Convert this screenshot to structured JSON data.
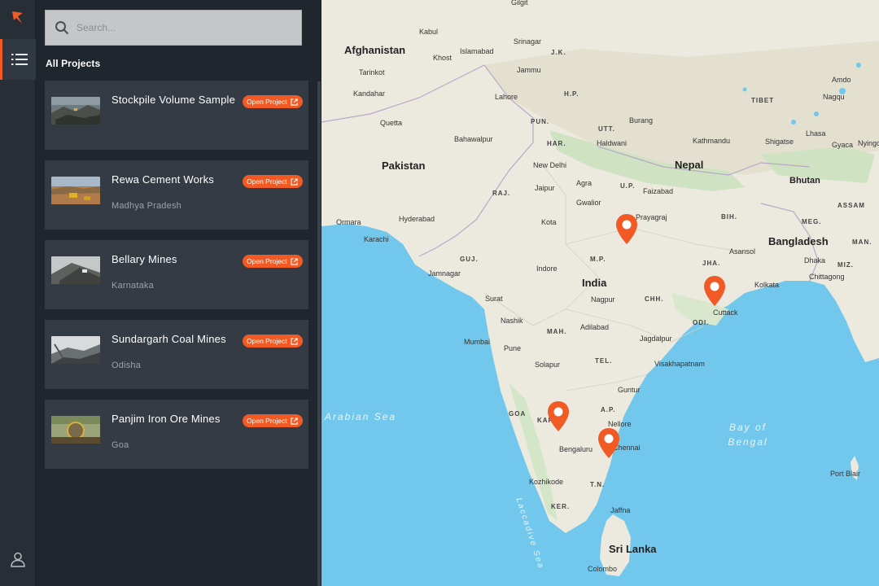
{
  "app": {
    "brand_color": "#f15a24"
  },
  "search": {
    "placeholder": "Search..."
  },
  "sidebar": {
    "section_title": "All Projects"
  },
  "projects": [
    {
      "title": "Stockpile Volume Sample",
      "subtitle": "",
      "button": "Open Project"
    },
    {
      "title": "Rewa Cement Works",
      "subtitle": "Madhya Pradesh",
      "button": "Open Project"
    },
    {
      "title": "Bellary Mines",
      "subtitle": "Karnataka",
      "button": "Open Project"
    },
    {
      "title": "Sundargarh Coal Mines",
      "subtitle": "Odisha",
      "button": "Open Project"
    },
    {
      "title": "Panjim Iron Ore Mines",
      "subtitle": "Goa",
      "button": "Open Project"
    }
  ],
  "map": {
    "countries": [
      "Afghanistan",
      "Pakistan",
      "Nepal",
      "Bhutan",
      "Bangladesh",
      "India",
      "Sri Lanka"
    ],
    "states": [
      "J.K.",
      "H.P.",
      "PUN.",
      "UTT.",
      "HAR.",
      "RAJ.",
      "U.P.",
      "BIH.",
      "GUJ.",
      "M.P.",
      "JHA.",
      "CHH.",
      "ODI.",
      "MAH.",
      "TEL.",
      "A.P.",
      "KAR.",
      "GOA",
      "T.N.",
      "KER.",
      "TIBET",
      "ASSAM",
      "MEG.",
      "MAN.",
      "MIZ."
    ],
    "cities": [
      "Gilgit",
      "Kabul",
      "Srinagar",
      "Khost",
      "Islamabad",
      "Jammu",
      "Tarinkot",
      "Kandahar",
      "Lahore",
      "Quetta",
      "Bahawalpur",
      "Burang",
      "Haldwani",
      "New Delhi",
      "Kathmandu",
      "Lhasa",
      "Gyaca",
      "Nyingchi",
      "Shigatse",
      "Amdo",
      "Nagqu",
      "Jaipur",
      "Agra",
      "Faizabad",
      "Gwalior",
      "Prayagraj",
      "Hyderabad",
      "Ormara",
      "Karachi",
      "Kota",
      "Asansol",
      "Dhaka",
      "Chittagong",
      "Kolkata",
      "Jamnagar",
      "Indore",
      "Surat",
      "Nagpur",
      "Cuttack",
      "Nashik",
      "Adilabad",
      "Mumbai",
      "Pune",
      "Jagdalpur",
      "Solapur",
      "Visakhapatnam",
      "Guntur",
      "Nellore",
      "Bengaluru",
      "Chennai",
      "Kozhikode",
      "Jaffna",
      "Colombo",
      "Port Blair"
    ],
    "water": [
      "Arabian Sea",
      "Bay of Bengal",
      "Laccadive Sea"
    ],
    "pin_color": "#f15a24"
  }
}
